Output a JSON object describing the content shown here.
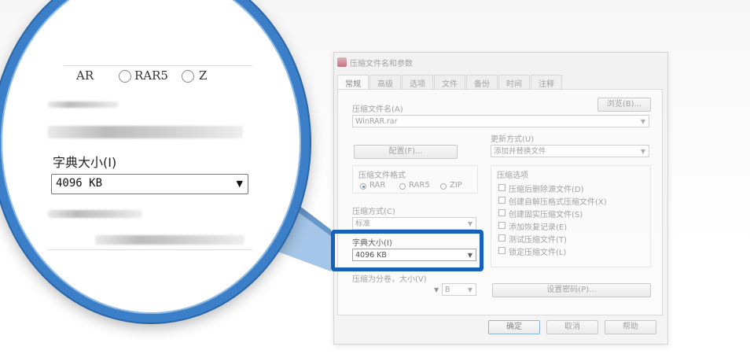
{
  "dialog": {
    "title": "压缩文件名和参数",
    "tabs": [
      "常规",
      "高级",
      "选项",
      "文件",
      "备份",
      "时间",
      "注释"
    ],
    "archive_name_label": "压缩文件名(A)",
    "browse_button": "浏览(B)...",
    "archive_name_value": "WinRAR.rar",
    "update_mode_label": "更新方式(U)",
    "update_mode_value": "添加并替换文件",
    "profiles_button": "配置(F)...",
    "format_group_label": "压缩文件格式",
    "format_options": [
      "RAR",
      "RAR5",
      "ZIP"
    ],
    "format_selected": "RAR",
    "options_group_label": "压缩选项",
    "options": [
      "压缩后删除源文件(D)",
      "创建自解压格式压缩文件(X)",
      "创建固实压缩文件(S)",
      "添加恢复记录(E)",
      "测试压缩文件(T)",
      "锁定压缩文件(L)"
    ],
    "method_label": "压缩方式(C)",
    "method_value": "标准",
    "dict_label": "字典大小(I)",
    "dict_value": "4096 KB",
    "split_label": "压缩为分卷，大小(V)",
    "split_unit": "B",
    "password_button": "设置密码(P)...",
    "ok_button": "确定",
    "cancel_button": "取消",
    "help_button": "帮助"
  },
  "magnifier": {
    "format_partial_left": "AR",
    "format_mid": "RAR5",
    "format_partial_right": "Z",
    "dict_label": "字典大小(I)",
    "dict_value": "4096 KB"
  },
  "colors": {
    "highlight": "#1762b8",
    "magnifier_ring": "#3b7fc8"
  }
}
